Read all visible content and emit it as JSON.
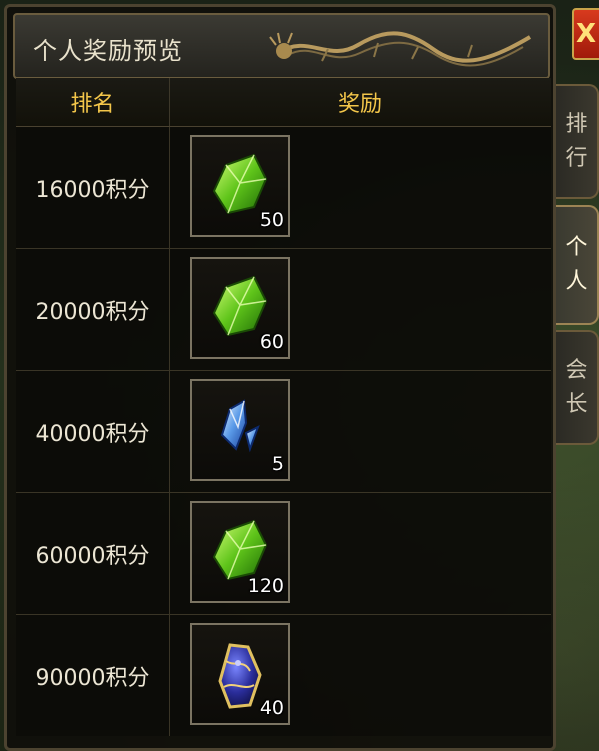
{
  "panel": {
    "title": "个人奖励预览",
    "close_label": "X"
  },
  "side_tabs": [
    {
      "label": [
        "排",
        "行"
      ],
      "active": false
    },
    {
      "label": [
        "个",
        "人"
      ],
      "active": true
    },
    {
      "label": [
        "会",
        "长"
      ],
      "active": false
    }
  ],
  "table": {
    "headers": {
      "rank": "排名",
      "reward": "奖励"
    },
    "rows": [
      {
        "rank": "16000积分",
        "item_icon": "green-gem-icon",
        "quantity": "50"
      },
      {
        "rank": "20000积分",
        "item_icon": "green-gem-icon",
        "quantity": "60"
      },
      {
        "rank": "40000积分",
        "item_icon": "blue-crystal-icon",
        "quantity": "5"
      },
      {
        "rank": "60000积分",
        "item_icon": "green-gem-icon",
        "quantity": "120"
      },
      {
        "rank": "90000积分",
        "item_icon": "blue-gold-stone-icon",
        "quantity": "40"
      }
    ]
  },
  "colors": {
    "header_text": "#f3c64a",
    "title_text": "#e9e2cc",
    "cell_text": "#ece6d4",
    "close_bg": "#d83a1e"
  }
}
